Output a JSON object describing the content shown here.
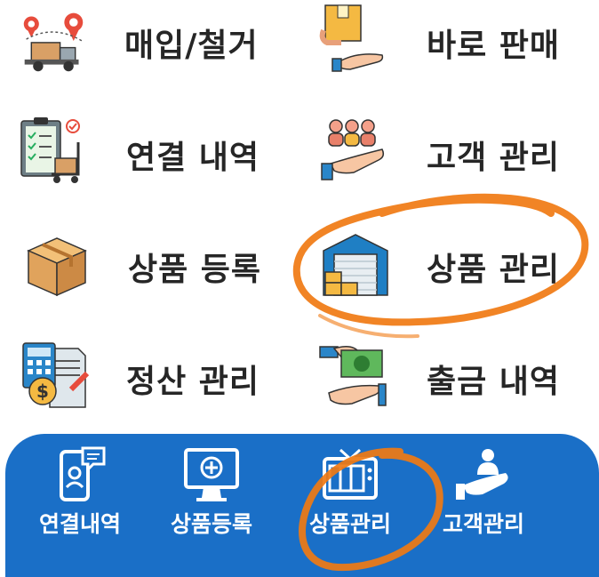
{
  "menu": {
    "items": [
      {
        "label": "매입/철거",
        "icon": "delivery-truck-icon"
      },
      {
        "label": "바로 판매",
        "icon": "hand-box-icon"
      },
      {
        "label": "연결 내역",
        "icon": "clipboard-cart-icon"
      },
      {
        "label": "고객 관리",
        "icon": "hand-people-icon"
      },
      {
        "label": "상품 등록",
        "icon": "box-icon"
      },
      {
        "label": "상품 관리",
        "icon": "warehouse-icon"
      },
      {
        "label": "정산 관리",
        "icon": "calculator-invoice-icon"
      },
      {
        "label": "출금 내역",
        "icon": "hand-cash-icon"
      }
    ]
  },
  "bottom_nav": {
    "items": [
      {
        "label": "연결내역",
        "icon": "phone-chat-icon"
      },
      {
        "label": "상품등록",
        "icon": "monitor-plus-icon"
      },
      {
        "label": "상품관리",
        "icon": "tv-box-icon"
      },
      {
        "label": "고객관리",
        "icon": "hand-person-icon"
      }
    ]
  },
  "colors": {
    "nav_background": "#1a6fc7",
    "highlight": "#f07a12",
    "text": "#262626"
  }
}
